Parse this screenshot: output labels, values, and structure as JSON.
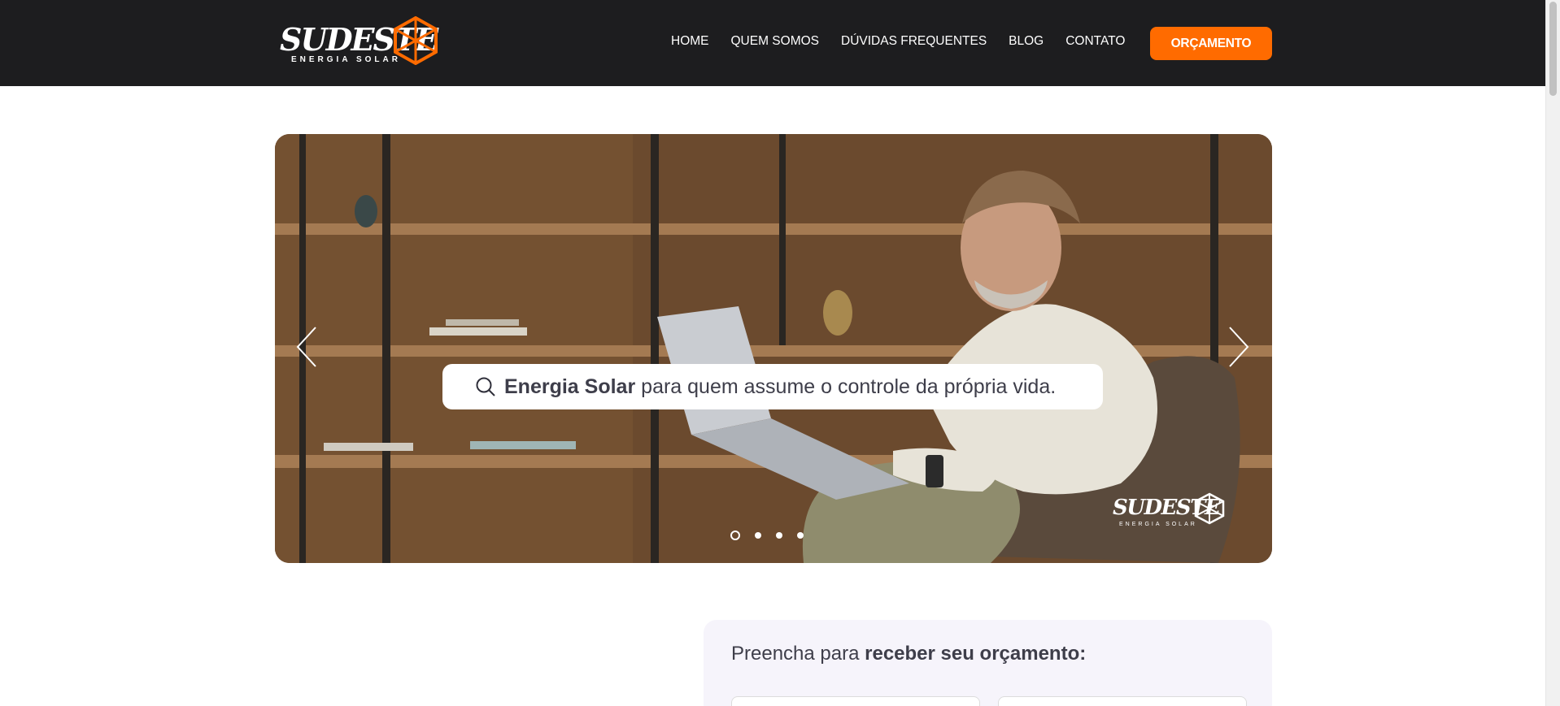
{
  "header": {
    "logo_word": "SUDESTE",
    "logo_sub": "ENERGIA SOLAR",
    "nav": [
      "HOME",
      "QUEM SOMOS",
      "DÚVIDAS FREQUENTES",
      "BLOG",
      "CONTATO"
    ],
    "cta_label": "ORÇAMENTO"
  },
  "hero": {
    "search_bold": "Energia Solar",
    "search_rest": "para quem assume o controle da própria vida.",
    "slides_count": 4,
    "active_slide": 1,
    "logo_word": "SUDESTE",
    "logo_sub": "ENERGIA SOLAR"
  },
  "form": {
    "title_prefix": "Preencha para",
    "title_bold": "receber seu orçamento:"
  },
  "icons": [
    "logo-mark-icon",
    "chevron-left-icon",
    "chevron-right-icon",
    "search-icon"
  ],
  "colors": {
    "accent": "#ff6b00",
    "header_bg": "#1d1d1f",
    "form_bg": "#f6f4fb"
  }
}
